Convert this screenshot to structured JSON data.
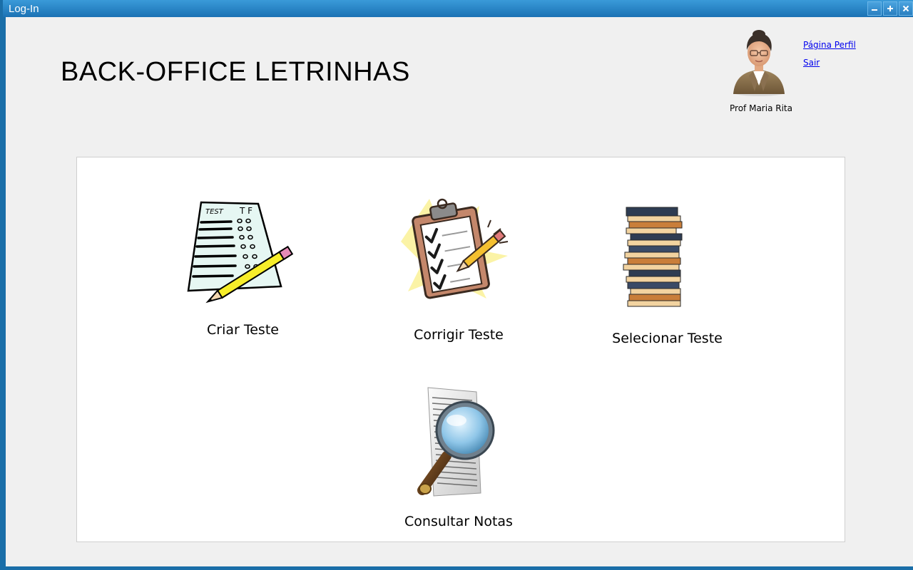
{
  "window": {
    "title": "Log-In",
    "controls": [
      "minimize-icon",
      "maximize-icon",
      "close-icon"
    ]
  },
  "header": {
    "app_title": "BACK-OFFICE LETRINHAS",
    "user_name": "Prof Maria Rita",
    "links": {
      "profile": "Página Perfil",
      "logout": "Sair"
    }
  },
  "menu": {
    "items": [
      {
        "label": "Criar Teste",
        "icon": "test-sheet-pencil-icon"
      },
      {
        "label": "Corrigir Teste",
        "icon": "clipboard-checklist-icon"
      },
      {
        "label": "Selecionar Teste",
        "icon": "book-stack-icon"
      },
      {
        "label": "Consultar Notas",
        "icon": "document-magnifier-icon"
      }
    ]
  },
  "colors": {
    "window_frame": "#1a6ea8",
    "background": "#f0f0f0",
    "panel": "#ffffff",
    "link": "#0000ee"
  }
}
